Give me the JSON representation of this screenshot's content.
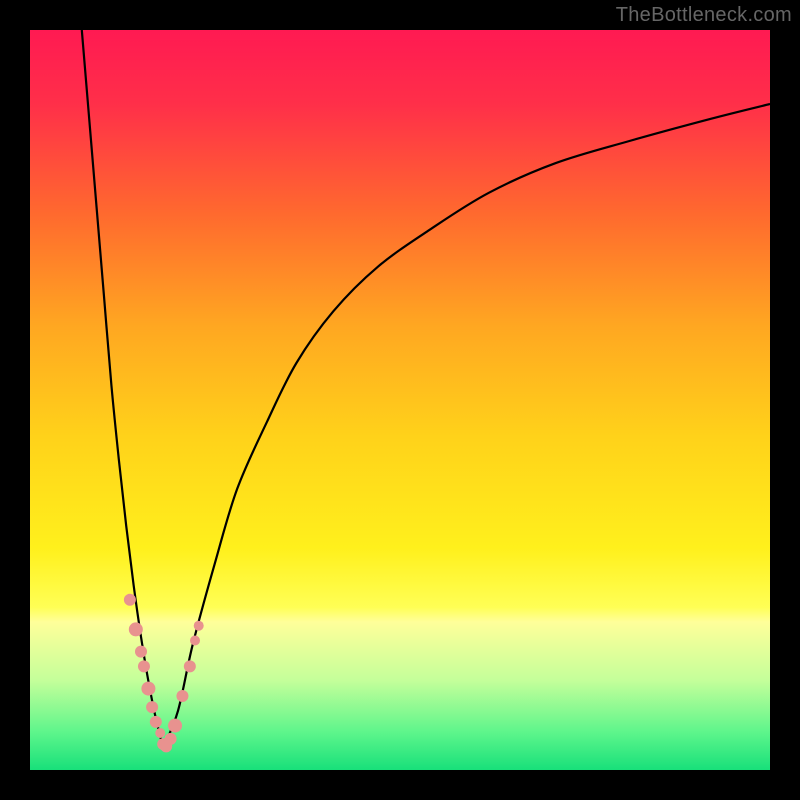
{
  "attribution": "TheBottleneck.com",
  "colors": {
    "frame": "#000000",
    "curve": "#000000",
    "marker_fill": "#e8928f",
    "attribution_text": "#666666"
  },
  "chart_data": {
    "type": "line",
    "title": "",
    "xlabel": "",
    "ylabel": "",
    "xlim": [
      0,
      100
    ],
    "ylim": [
      0,
      100
    ],
    "gradient_stops": [
      {
        "pos": 0.0,
        "color": "#ff1a52"
      },
      {
        "pos": 0.1,
        "color": "#ff2f49"
      },
      {
        "pos": 0.25,
        "color": "#ff6a2e"
      },
      {
        "pos": 0.4,
        "color": "#ffa721"
      },
      {
        "pos": 0.55,
        "color": "#ffd21a"
      },
      {
        "pos": 0.7,
        "color": "#fff01c"
      },
      {
        "pos": 0.78,
        "color": "#ffff55"
      },
      {
        "pos": 0.8,
        "color": "#ffff9a"
      },
      {
        "pos": 0.88,
        "color": "#c3ff9a"
      },
      {
        "pos": 0.95,
        "color": "#5cf58b"
      },
      {
        "pos": 1.0,
        "color": "#18e07a"
      }
    ],
    "series": [
      {
        "name": "left-branch",
        "x": [
          7,
          8,
          9,
          10,
          11,
          12,
          13,
          14,
          15,
          16,
          17,
          18
        ],
        "y": [
          100,
          88,
          76,
          64,
          52,
          42,
          33,
          25,
          18,
          12,
          7,
          3
        ]
      },
      {
        "name": "right-branch",
        "x": [
          18,
          20,
          22,
          25,
          28,
          32,
          36,
          41,
          47,
          54,
          62,
          71,
          81,
          92,
          100
        ],
        "y": [
          3,
          8,
          17,
          28,
          38,
          47,
          55,
          62,
          68,
          73,
          78,
          82,
          85,
          88,
          90
        ]
      }
    ],
    "markers": {
      "name": "highlight-points",
      "x": [
        13.5,
        14.3,
        15.0,
        15.4,
        16.0,
        16.5,
        17.0,
        17.6,
        18.0,
        18.4,
        19.0,
        19.6,
        20.6,
        21.6,
        22.3,
        22.8
      ],
      "y": [
        23,
        19,
        16,
        14,
        11,
        8.5,
        6.5,
        5,
        3.5,
        3.2,
        4.2,
        6,
        10,
        14,
        17.5,
        19.5
      ],
      "r": [
        6,
        7,
        6,
        6,
        7,
        6,
        6,
        5,
        6,
        6,
        6,
        7,
        6,
        6,
        5,
        5
      ]
    }
  }
}
